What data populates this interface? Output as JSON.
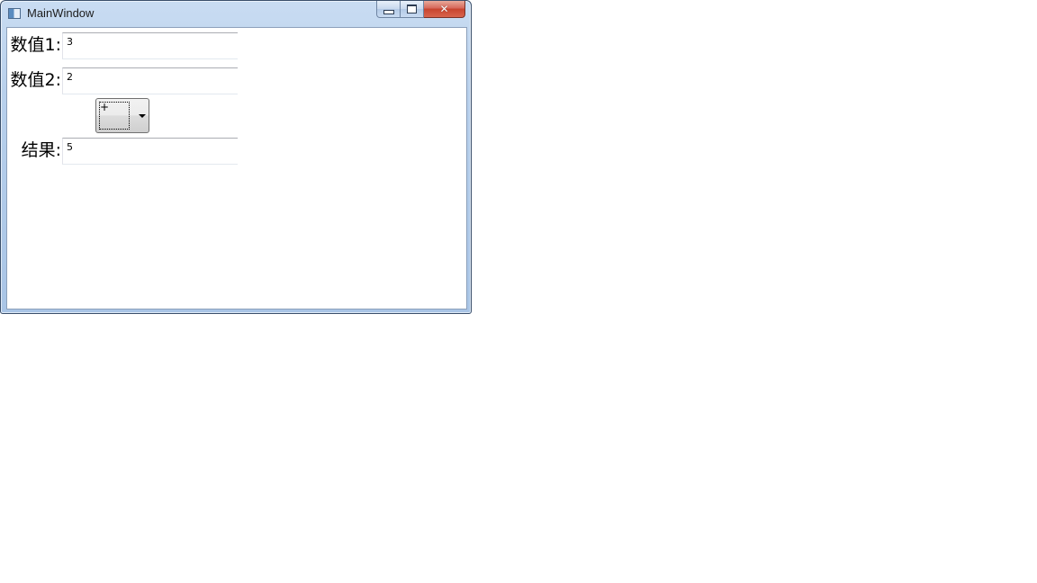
{
  "window": {
    "title": "MainWindow",
    "icon": "app-window-icon",
    "caption_buttons": [
      "minimize-icon",
      "maximize-icon",
      "close-icon"
    ]
  },
  "form": {
    "value1": {
      "label": "数值1:",
      "value": "3"
    },
    "value2": {
      "label": "数值2:",
      "value": "2"
    },
    "operator": {
      "selected": "+",
      "icon": "chevron-down-icon"
    },
    "result": {
      "label": "结果:",
      "value": "5"
    }
  }
}
